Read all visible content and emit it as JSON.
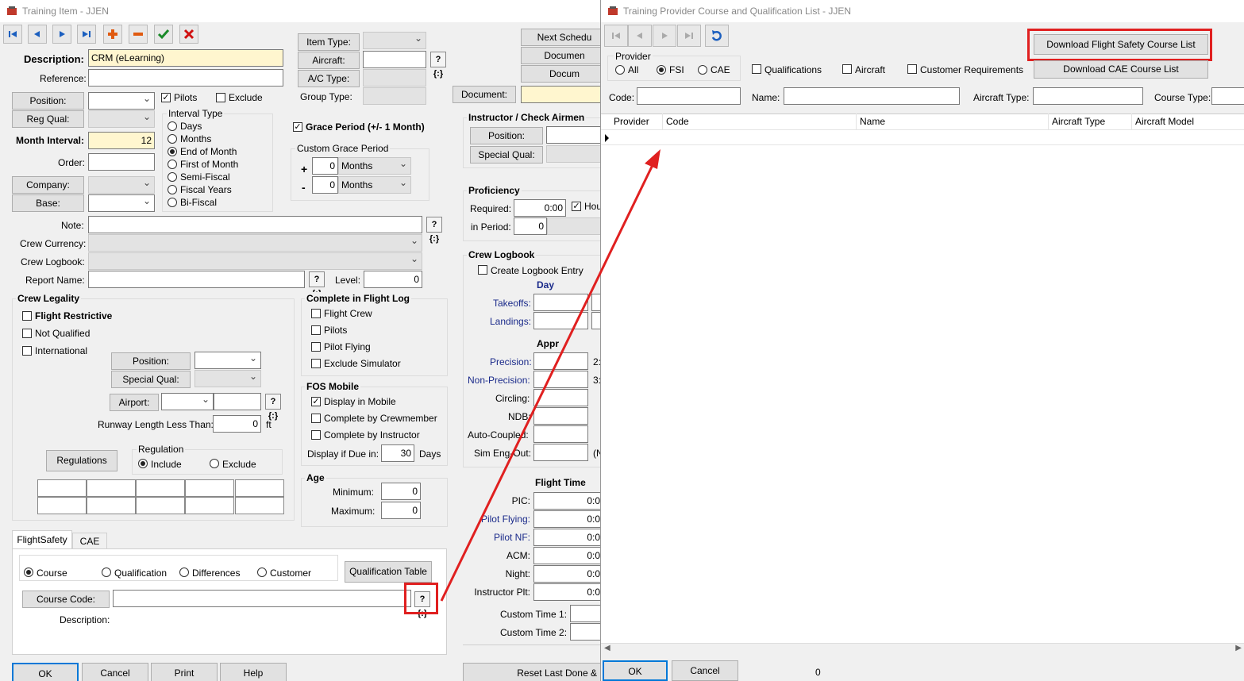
{
  "left_window": {
    "title": "Training Item - JJEN",
    "description": {
      "label": "Description:",
      "value": "CRM (eLearning)"
    },
    "reference": {
      "label": "Reference:"
    },
    "position_btn": "Position:",
    "reg_qual_btn": "Reg Qual:",
    "pilots": "Pilots",
    "exclude": "Exclude",
    "interval_type": {
      "label": "Interval Type",
      "options": [
        "Days",
        "Months",
        "End of Month",
        "First of Month",
        "Semi-Fiscal",
        "Fiscal Years",
        "Bi-Fiscal"
      ],
      "selected": "End of Month"
    },
    "month_interval": {
      "label": "Month Interval:",
      "value": "12"
    },
    "order": "Order:",
    "company_btn": "Company:",
    "base_btn": "Base:",
    "item_type_btn": "Item Type:",
    "aircraft_btn": "Aircraft:",
    "ac_type_btn": "A/C Type:",
    "group_type": "Group Type:",
    "grace_period": "Grace Period (+/- 1 Month)",
    "custom_grace": {
      "label": "Custom Grace Period",
      "plus": "+",
      "minus": "-",
      "plus_value": "0",
      "minus_value": "0",
      "unit": "Months"
    },
    "note": "Note:",
    "crew_currency": "Crew Currency:",
    "crew_logbook": "Crew Logbook:",
    "report_name": "Report Name:",
    "level": {
      "label": "Level:",
      "value": "0"
    },
    "crew_legality": {
      "title": "Crew Legality",
      "flight_restrictive": "Flight Restrictive",
      "not_qualified": "Not Qualified",
      "international": "International",
      "position_btn": "Position:",
      "special_qual_btn": "Special Qual:",
      "airport_btn": "Airport:",
      "runway_label": "Runway Length Less Than:",
      "runway_value": "0",
      "runway_unit": "ft",
      "regulations_btn": "Regulations",
      "regulation": "Regulation",
      "include": "Include",
      "exclude": "Exclude"
    },
    "complete_in_flight_log": {
      "title": "Complete in Flight Log",
      "items": [
        "Flight Crew",
        "Pilots",
        "Pilot Flying",
        "Exclude Simulator"
      ]
    },
    "fos_mobile": {
      "title": "FOS Mobile",
      "display_in_mobile": "Display in Mobile",
      "complete_by_crewmember": "Complete by Crewmember",
      "complete_by_instructor": "Complete by Instructor",
      "display_if_due_in": "Display if Due in:",
      "due_value": "30",
      "due_unit": "Days"
    },
    "age": {
      "title": "Age",
      "minimum": "Minimum:",
      "maximum": "Maximum:",
      "min_value": "0",
      "max_value": "0"
    },
    "tabs": [
      "FlightSafety",
      "CAE"
    ],
    "fs_options": [
      "Course",
      "Qualification",
      "Differences",
      "Customer"
    ],
    "qualification_table_btn": "Qualification Table",
    "course_code_btn": "Course Code:",
    "description2": "Description:",
    "next_sched_btn": "Next Schedu",
    "document_btn1": "Documen",
    "document_btn2": "Docum",
    "document_btn3": "Document:",
    "instructor": {
      "title": "Instructor / Check Airmen",
      "position_btn": "Position:",
      "special_qual_btn": "Special Qual:"
    },
    "proficiency": {
      "title": "Proficiency",
      "required": "Required:",
      "required_value": "0:00",
      "hours": "Hou",
      "in_period": "in Period:",
      "period_value": "0"
    },
    "crew_logbook_group": {
      "title": "Crew Logbook",
      "create_entry": "Create Logbook Entry",
      "day": "Day",
      "takeoffs": "Takeoffs:",
      "landings": "Landings:",
      "appr": "Appr",
      "precision": "Precision:",
      "non_precision": "Non-Precision:",
      "circling": "Circling:",
      "ndb": "NDB:",
      "auto_coupled": "Auto-Coupled:",
      "sim_eng_out": "Sim Eng-Out:",
      "frag1": "2:",
      "frag2": "3:",
      "frag3": "(N"
    },
    "flight_time": {
      "title": "Flight Time",
      "rows": [
        "PIC:",
        "Pilot Flying:",
        "Pilot NF:",
        "ACM:",
        "Night:",
        "Instructor Plt:"
      ],
      "value": "0:0",
      "custom1": "Custom Time 1:",
      "custom2": "Custom Time 2:"
    },
    "bottom_buttons": {
      "ok": "OK",
      "cancel": "Cancel",
      "print": "Print",
      "help": "Help",
      "reset": "Reset Last Done &"
    }
  },
  "right_window": {
    "title": "Training Provider Course and Qualification List - JJEN",
    "download_fs_btn": "Download Flight Safety Course List",
    "download_cae_btn": "Download CAE Course List",
    "provider": {
      "label": "Provider",
      "options": [
        "All",
        "FSI",
        "CAE"
      ],
      "selected": "FSI"
    },
    "qualifications": "Qualifications",
    "aircraft": "Aircraft",
    "customer_requirements": "Customer Requirements",
    "code": "Code:",
    "name": "Name:",
    "aircraft_type": "Aircraft Type:",
    "course_type": "Course Type:",
    "columns": [
      "Provider",
      "Code",
      "Name",
      "Aircraft Type",
      "Aircraft Model"
    ],
    "ok": "OK",
    "cancel": "Cancel",
    "count": "0"
  },
  "colors": {
    "highlight_red": "#e02020",
    "field_yellow": "#fff6cf",
    "label_blue": "#1a2a8a"
  }
}
